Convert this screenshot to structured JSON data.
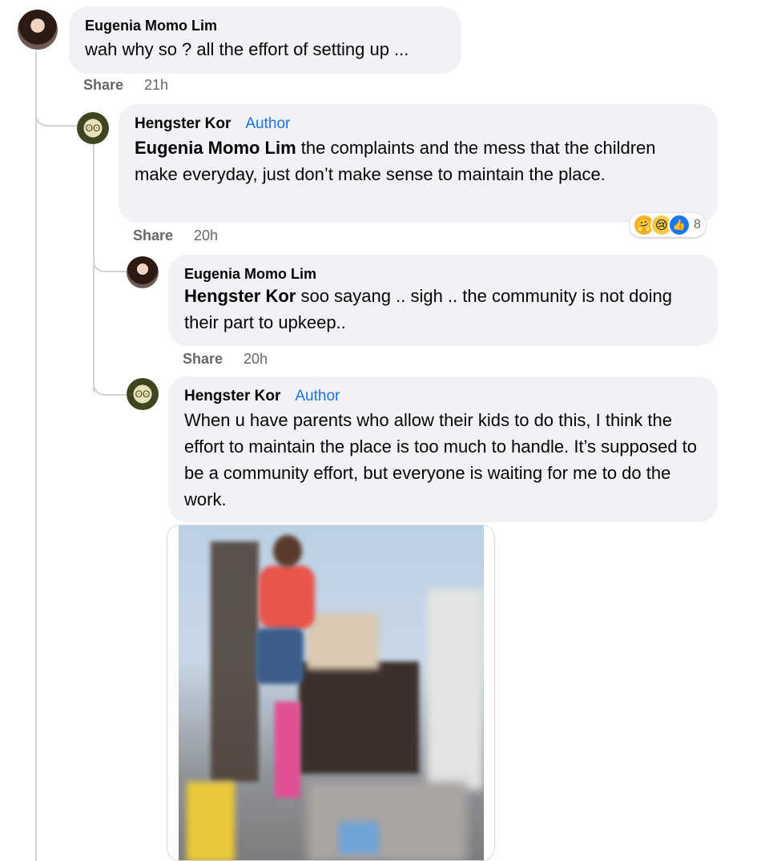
{
  "comments": [
    {
      "author": "Eugenia Momo Lim",
      "text": "wah why so ? all the effort of setting up ...",
      "share_label": "Share",
      "time": "21h"
    },
    {
      "author": "Hengster Kor",
      "badge": "Author",
      "mention": "Eugenia Momo Lim",
      "text": " the complaints and the mess that the children make everyday, just don’t make sense to maintain the place.",
      "share_label": "Share",
      "time": "20h",
      "reaction_count": "8"
    },
    {
      "author": "Eugenia Momo Lim",
      "mention": "Hengster Kor",
      "text": " soo sayang .. sigh .. the community is not doing their part to upkeep..",
      "share_label": "Share",
      "time": "20h"
    },
    {
      "author": "Hengster Kor",
      "badge": "Author",
      "text": "When u have parents who allow their kids to do this, I think the effort to maintain the place is too much to handle. It’s supposed to be a community effort, but everyone is waiting for me to do the work."
    }
  ],
  "icons": {
    "reaction_care": "care-reaction-icon",
    "reaction_sad": "sad-reaction-icon",
    "reaction_like": "like-reaction-icon"
  },
  "colors": {
    "bubble": "#f0f2f5",
    "author_badge": "#1b74e4",
    "meta_text": "#65676b"
  }
}
